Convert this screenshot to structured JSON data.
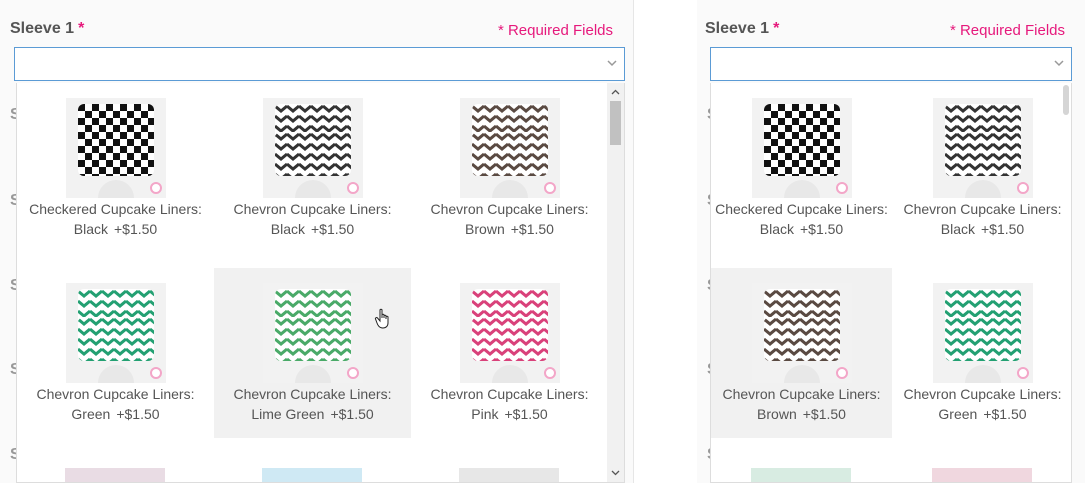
{
  "colors": {
    "accent_pink": "#e6197c",
    "focus_border": "#5b9bd5",
    "hover_bg": "#f1f1f1",
    "checkered": [
      "#111111",
      "#ffffff"
    ],
    "chevron_black": [
      "#333333",
      "#ffffff"
    ],
    "chevron_brown": [
      "#5a4a42",
      "#ffffff"
    ],
    "chevron_green": [
      "#23a072",
      "#ffffff"
    ],
    "chevron_lime": [
      "#4aaa68",
      "#ffffff"
    ],
    "chevron_pink": [
      "#d9417a",
      "#ffffff"
    ]
  },
  "icons": {
    "select_arrow": "chevron-down-icon",
    "brand": "bakery-logo-icon",
    "cursor": "hand-pointer-icon"
  },
  "left": {
    "sleeve_label": "Sleeve 1",
    "required_star": "*",
    "required_fields": "* Required Fields",
    "select_value": "",
    "background_labels": [
      "S",
      "S",
      "S",
      "S",
      "S"
    ],
    "options": [
      {
        "name": "Checkered Cupcake Liners: Black",
        "price": "+$1.50",
        "pattern": "checkered"
      },
      {
        "name": "Chevron Cupcake Liners: Black",
        "price": "+$1.50",
        "pattern": "chevron_black"
      },
      {
        "name": "Chevron Cupcake Liners: Brown",
        "price": "+$1.50",
        "pattern": "chevron_brown"
      },
      {
        "name": "Chevron Cupcake Liners: Green",
        "price": "+$1.50",
        "pattern": "chevron_green"
      },
      {
        "name": "Chevron Cupcake Liners: Lime Green",
        "price": "+$1.50",
        "pattern": "chevron_lime",
        "hovered": true
      },
      {
        "name": "Chevron Cupcake Liners: Pink",
        "price": "+$1.50",
        "pattern": "chevron_pink"
      }
    ]
  },
  "right": {
    "sleeve_label": "Sleeve 1",
    "required_star": "*",
    "required_fields": "* Required Fields",
    "select_value": "",
    "background_labels": [
      "S",
      "S",
      "S",
      "S",
      "S"
    ],
    "options": [
      {
        "name": "Checkered Cupcake Liners: Black",
        "price": "+$1.50",
        "pattern": "checkered"
      },
      {
        "name": "Chevron Cupcake Liners: Black",
        "price": "+$1.50",
        "pattern": "chevron_black"
      },
      {
        "name": "Chevron Cupcake Liners: Brown",
        "price": "+$1.50",
        "pattern": "chevron_brown",
        "hovered": true
      },
      {
        "name": "Chevron Cupcake Liners: Green",
        "price": "+$1.50",
        "pattern": "chevron_green"
      }
    ]
  }
}
